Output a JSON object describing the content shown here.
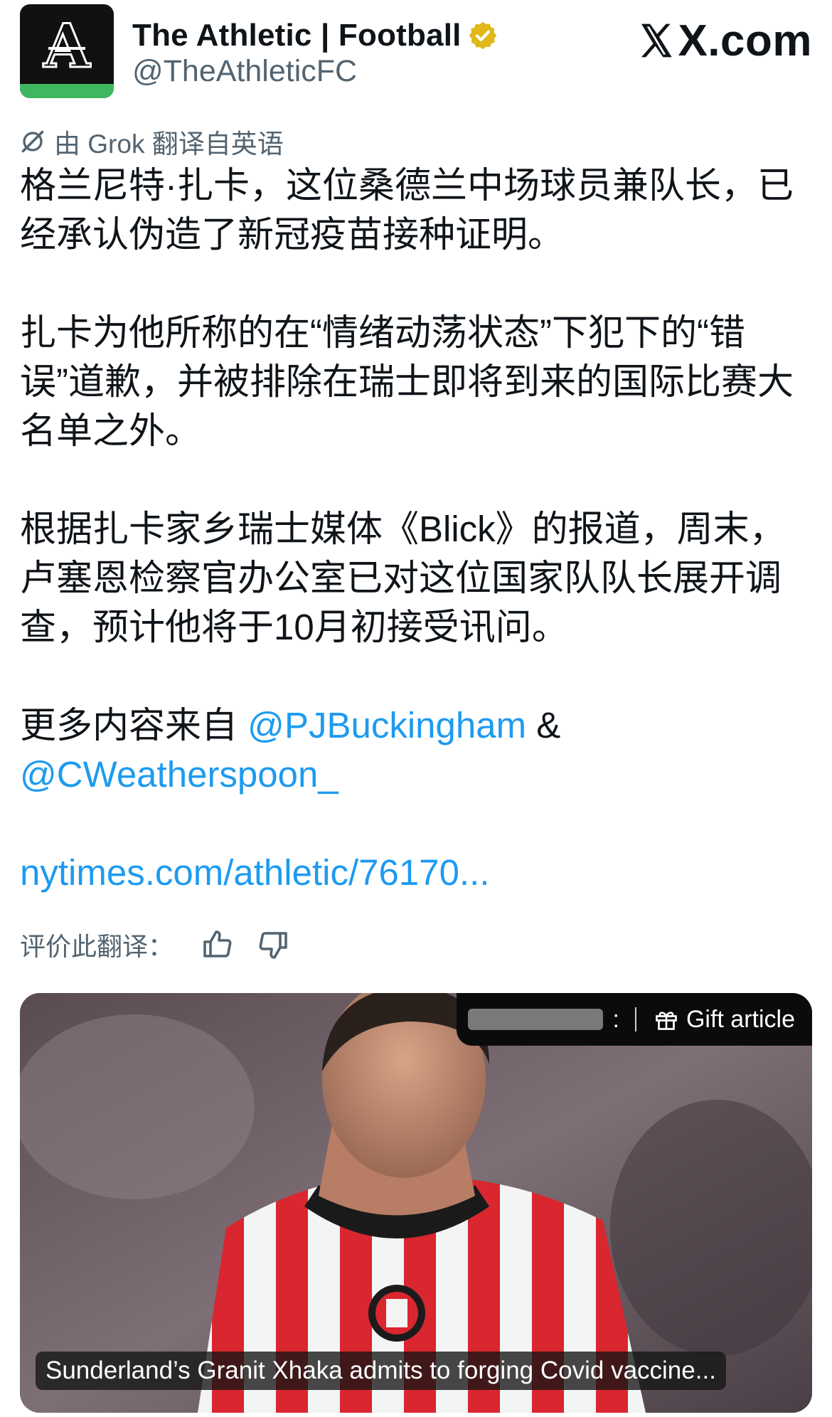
{
  "account": {
    "display_name": "The Athletic | Football",
    "handle": "@TheAthleticFC",
    "avatar_letter": "A",
    "verified_badge_icon": "gold-verified-badge-icon"
  },
  "site": {
    "watermark": "X.com"
  },
  "translation": {
    "notice": "由 Grok 翻译自英语",
    "rate_label": "评价此翻译："
  },
  "post": {
    "para1": "格兰尼特·扎卡，这位桑德兰中场球员兼队长，已经承认伪造了新冠疫苗接种证明。",
    "para2": "扎卡为他所称的在“情绪动荡状态”下犯下的“错误”道歉，并被排除在瑞士即将到来的国际比赛大名单之外。",
    "para3": "根据扎卡家乡瑞士媒体《Blick》的报道，周末，卢塞恩检察官办公室已对这位国家队队长展开调查，预计他将于10月初接受讯问。",
    "more_prefix": "更多内容来自 ",
    "mention1": "@PJBuckingham",
    "amp": " & ",
    "mention2": "@CWeatherspoon_",
    "link": "nytimes.com/athletic/76170..."
  },
  "card": {
    "kebab": ":",
    "gift_label": "Gift article",
    "caption": "Sunderland’s Granit Xhaka admits to forging Covid vaccine..."
  },
  "colors": {
    "link_blue": "#1d9bf0",
    "secondary_text": "#536471",
    "brand_green": "#3fb760",
    "verified_gold": "#e2b719"
  }
}
